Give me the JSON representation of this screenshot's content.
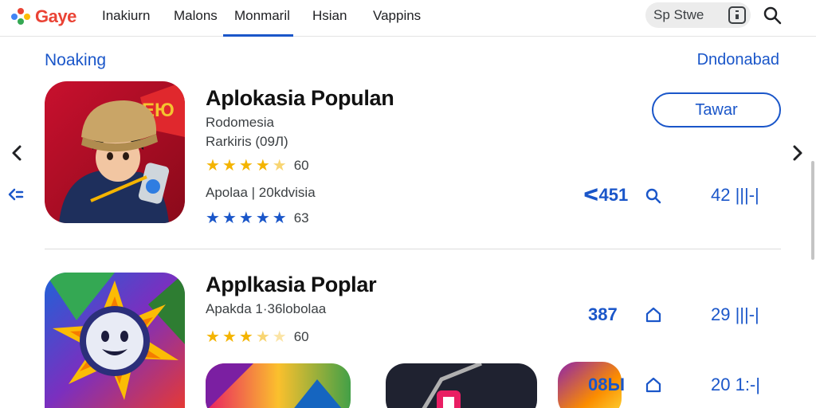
{
  "header": {
    "brand": "Gaye",
    "nav": [
      {
        "label": "Inakiurn"
      },
      {
        "label": "Malons"
      },
      {
        "label": "Monmaril"
      },
      {
        "label": "Hsian"
      },
      {
        "label": "Vappins"
      }
    ],
    "active_nav_index": 2,
    "store_label": "Sp Stwe",
    "icons": {
      "store": "store-icon",
      "search": "search-icon"
    }
  },
  "section": {
    "title": "Noaking",
    "download_link": "Dndonabad"
  },
  "apps": [
    {
      "title": "Aplokasia Populan",
      "subtitle": "Rodomesia",
      "category": "Rarkiris (09Л)",
      "rating_stars": 4.5,
      "rating_count": "60",
      "meta": "Apolaa  | 20kdvisia",
      "stat_left": "ᐸ451",
      "stat_right": "42 |||-|",
      "second_rating_stars": 5,
      "second_rating_count": "63",
      "install_label": "Tawar",
      "action_icon": "search-icon"
    },
    {
      "title": "Applkasia Poplar",
      "meta": "Apakda  1·36lobolaa",
      "rating_stars": 3.5,
      "rating_count": "60",
      "stat_left": "387",
      "stat_right": "29 |||-|",
      "action_icon": "home-icon"
    },
    {
      "stat_left": "08Ы",
      "stat_right": "20 1:-|",
      "action_icon": "home-icon"
    }
  ],
  "colors": {
    "accent": "#1a56c9",
    "star": "#f4b400",
    "divider": "#dcdcdc"
  }
}
